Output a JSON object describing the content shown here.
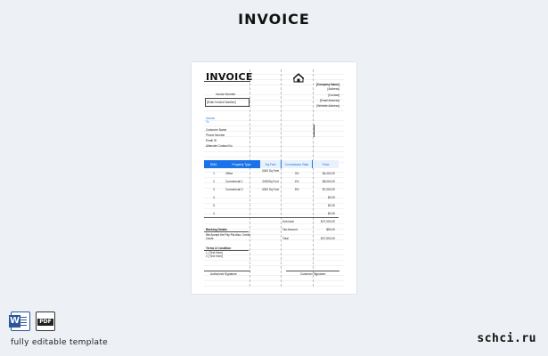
{
  "page": {
    "title": "INVOICE"
  },
  "invoice": {
    "title": "INVOICE",
    "company": [
      "[Company Name]",
      "[Address]",
      "[Contact]",
      "[Email Address]",
      "[Website Address]"
    ],
    "invoice_number_label": "Invoice Number",
    "invoice_number_value": "[Enter Invoice Number]",
    "invoice_to_label": "Invoice",
    "to_label": "To",
    "customer_fields": [
      "Customer Name",
      "Phone Number",
      "Email ID",
      "Alternate Contact No"
    ],
    "table": {
      "headers": [
        "SNO.",
        "Property Type",
        "Sq Feet",
        "Commission Rate",
        "Price"
      ],
      "rows": [
        [
          "1",
          "Office",
          "3000 Sq Feet",
          "3%",
          "$4,000.00"
        ],
        [
          "2",
          "Commercial 1",
          "2000Sq Foot",
          "4%",
          "$8,000.00"
        ],
        [
          "3",
          "Commercial 2",
          "4000 Sq Foot",
          "5%",
          "$7,000.00"
        ],
        [
          "4",
          "",
          "",
          "",
          "$0.00"
        ],
        [
          "5",
          "",
          "",
          "",
          "$0.00"
        ],
        [
          "4",
          "",
          "",
          "",
          "$0.00"
        ]
      ]
    },
    "subtotal_label": "Sub total",
    "subtotal_value": "$27,000.00",
    "tax_label": "Tax Amount",
    "tax_value": "$50.00",
    "total_label": "Total",
    "total_value": "$27,500.00",
    "banking_label": "Banking Details",
    "banking_note": "We Accept the Pay Pal Also, Credit Cards",
    "terms_label": "Terms & Condition",
    "terms": [
      "1. [Text Here]",
      "2. [Text Here]"
    ],
    "auth_signature": "Authorized Signature",
    "customer_signature": "Customer Signature"
  },
  "footer": {
    "icons": [
      "word-icon",
      "pdf-icon"
    ],
    "label": "fully editable template",
    "brand": "schci.ru"
  },
  "colors": {
    "accent": "#1a73e8",
    "background": "#edf0f4"
  }
}
